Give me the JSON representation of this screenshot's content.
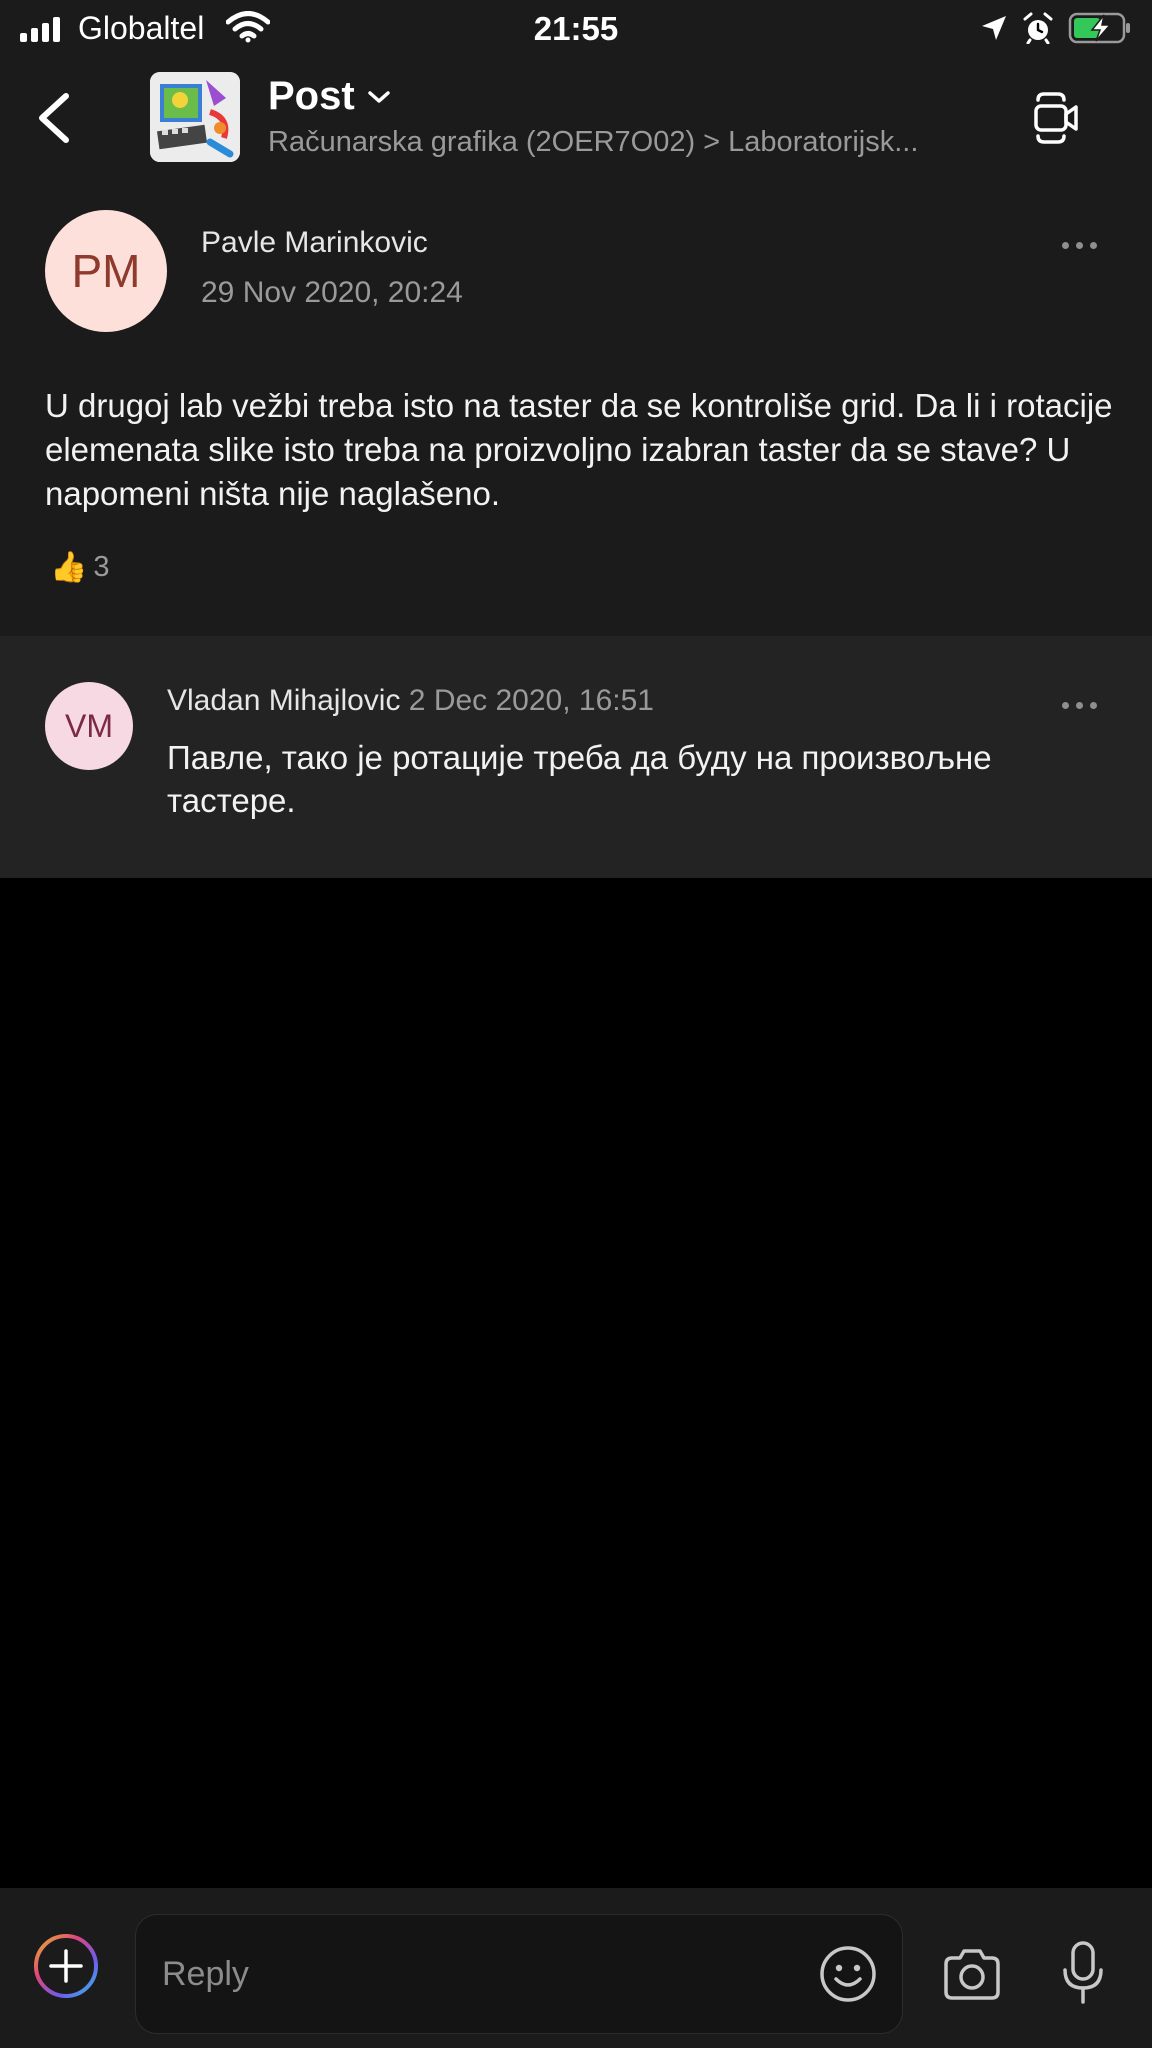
{
  "status_bar": {
    "carrier": "Globaltel",
    "time": "21:55",
    "icons": [
      "signal-icon",
      "wifi-icon",
      "location-arrow-icon",
      "alarm-icon",
      "battery-charging-icon"
    ]
  },
  "nav": {
    "title": "Post",
    "subtitle": "Računarska grafika (2OER7O02) > Laboratorijsk...",
    "icons": [
      "back-chevron-icon",
      "chevron-down-icon",
      "video-call-icon"
    ]
  },
  "post": {
    "avatar_initials": "PM",
    "author": "Pavle Marinkovic",
    "timestamp": "29 Nov 2020, 20:24",
    "body": "U drugoj lab vežbi treba isto na taster da se kontroliše grid. Da li i rotacije elemenata slike isto treba na proizvoljno izabran taster da se stave? U napomeni ništa nije naglašeno.",
    "reaction": {
      "emoji": "👍",
      "count": "3"
    }
  },
  "reply": {
    "avatar_initials": "VM",
    "author": "Vladan Mihajlovic",
    "timestamp": "2 Dec 2020, 16:51",
    "body": "Павле, тако је ротације треба да буду на произвољне тастере."
  },
  "compose": {
    "placeholder": "Reply",
    "icons": [
      "add-icon",
      "emoji-icon",
      "camera-icon",
      "microphone-icon"
    ]
  },
  "colors": {
    "background": "#000000",
    "surface": "#1b1b1b",
    "reply_surface": "#232323",
    "pm_avatar_bg": "#fde0da",
    "pm_avatar_fg": "#8e3a2c",
    "vm_avatar_bg": "#f6d9e2",
    "vm_avatar_fg": "#7a2a45",
    "battery_green": "#34c759"
  }
}
